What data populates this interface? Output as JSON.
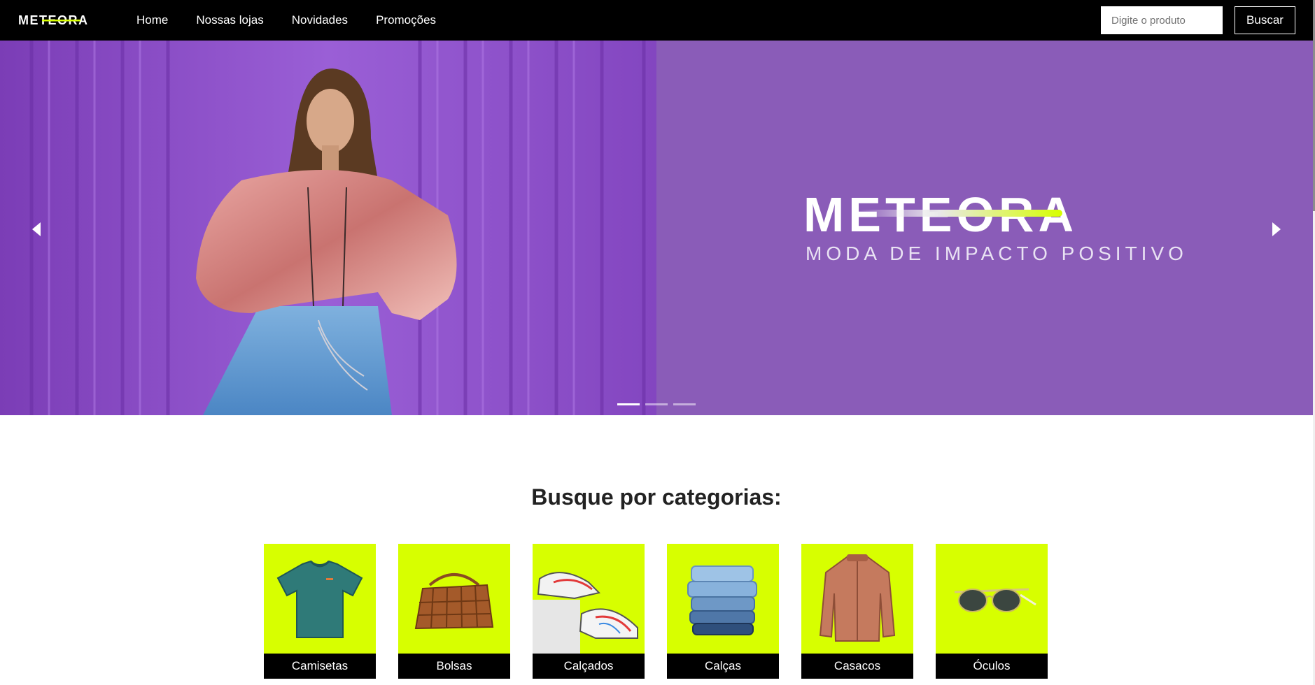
{
  "nav": {
    "brand": "METEORA",
    "links": [
      "Home",
      "Nossas lojas",
      "Novidades",
      "Promoções"
    ],
    "search_placeholder": "Digite o produto",
    "search_button": "Buscar"
  },
  "hero": {
    "brand": "METEORA",
    "tagline": "MODA DE IMPACTO POSITIVO",
    "slides_count": 3,
    "active_slide": 1
  },
  "categories": {
    "title": "Busque por categorias:",
    "items": [
      {
        "label": "Camisetas",
        "icon": "tshirt-image"
      },
      {
        "label": "Bolsas",
        "icon": "bag-image"
      },
      {
        "label": "Calçados",
        "icon": "sneakers-image"
      },
      {
        "label": "Calças",
        "icon": "jeans-image"
      },
      {
        "label": "Casacos",
        "icon": "jacket-image"
      },
      {
        "label": "Óculos",
        "icon": "sunglasses-image"
      }
    ]
  },
  "colors": {
    "navbar": "#000000",
    "accent": "#d7ff00",
    "hero_purple": "#8a5cb8"
  }
}
